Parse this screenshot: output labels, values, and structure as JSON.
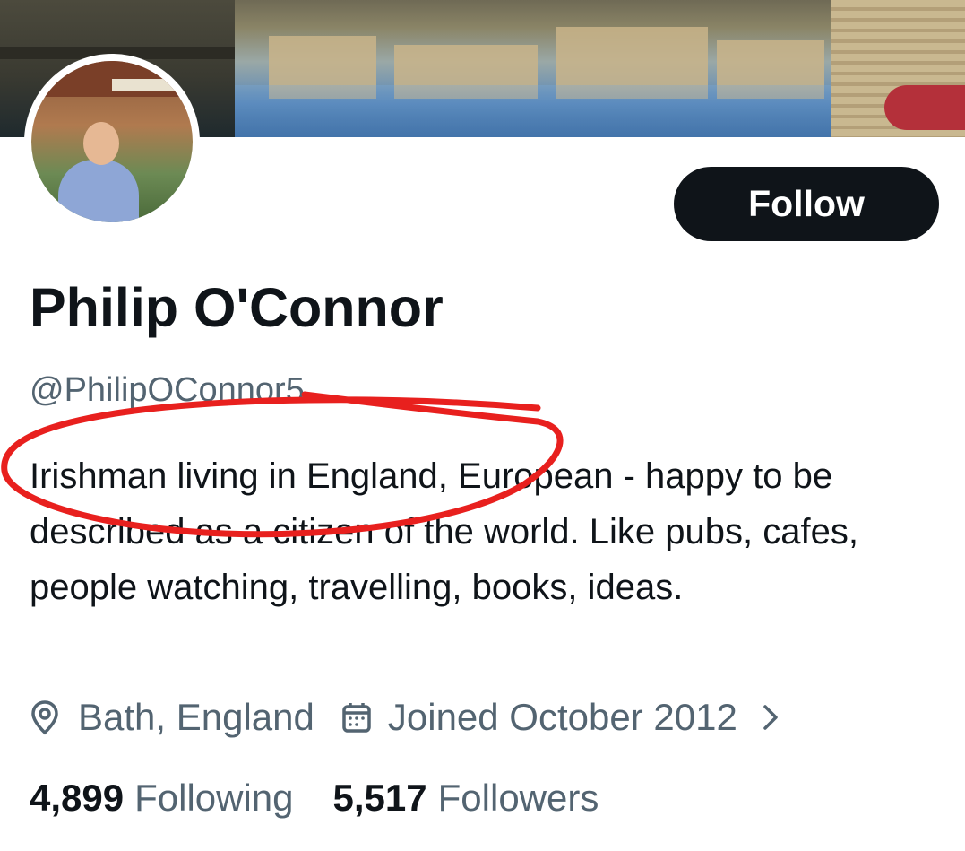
{
  "profile": {
    "follow_label": "Follow",
    "display_name": "Philip O'Connor",
    "handle": "@PhilipOConnor5",
    "bio": "Irishman living in England, European - happy to be described as a citizen of the world. Like pubs, cafes, people watching, travelling, books, ideas.",
    "location": "Bath, England",
    "joined": "Joined October 2012",
    "following_count": "4,899",
    "following_label": "Following",
    "followers_count": "5,517",
    "followers_label": "Followers"
  },
  "icons": {
    "location": "location-pin-icon",
    "joined": "calendar-icon",
    "more": "chevron-right-icon"
  },
  "colors": {
    "text_primary": "#0f1419",
    "text_secondary": "#536471",
    "button_bg": "#0f1419",
    "button_text": "#ffffff",
    "annotation": "#e8201e"
  }
}
